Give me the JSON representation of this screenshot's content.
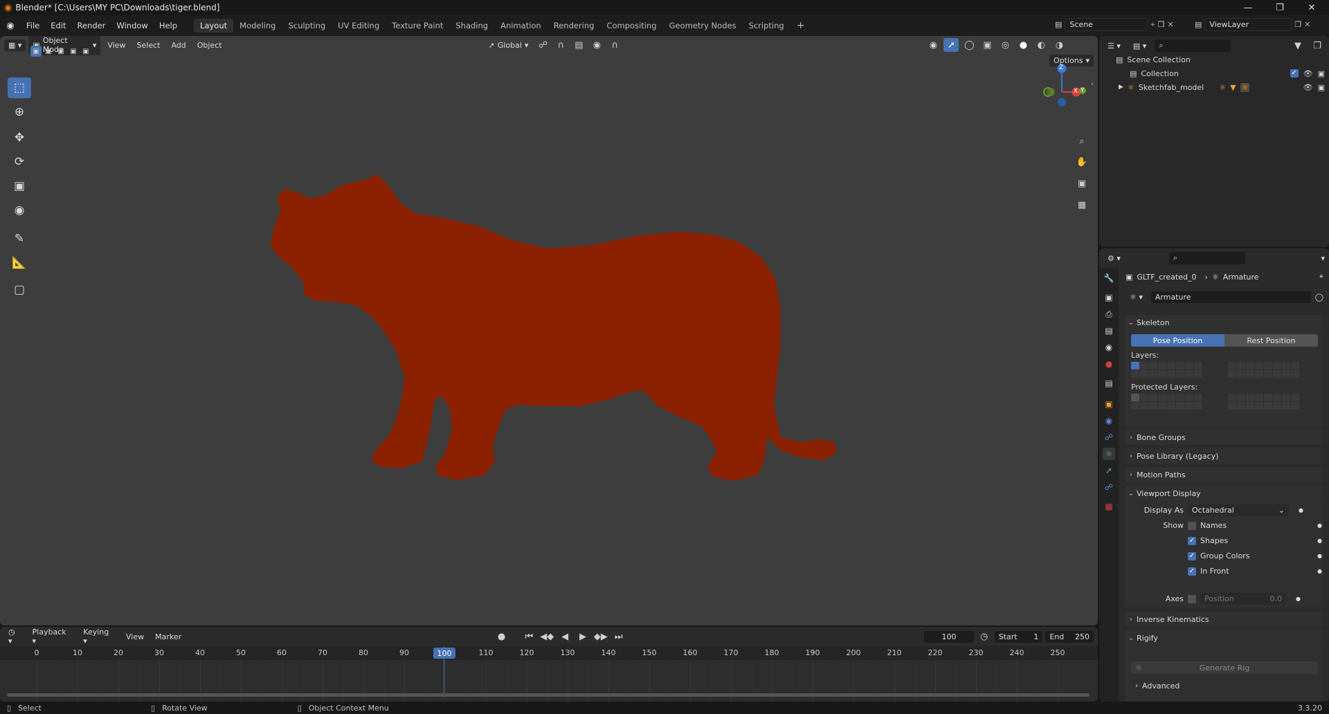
{
  "window": {
    "title": "Blender* [C:\\Users\\MY PC\\Downloads\\tiger.blend]",
    "version": "3.3.20"
  },
  "menus": [
    "File",
    "Edit",
    "Render",
    "Window",
    "Help"
  ],
  "workspaces": [
    "Layout",
    "Modeling",
    "Sculpting",
    "UV Editing",
    "Texture Paint",
    "Shading",
    "Animation",
    "Rendering",
    "Compositing",
    "Geometry Nodes",
    "Scripting"
  ],
  "active_workspace": "Layout",
  "scene": {
    "name": "Scene",
    "view_layer": "ViewLayer"
  },
  "viewport": {
    "mode": "Object Mode",
    "menu": [
      "View",
      "Select",
      "Add",
      "Object"
    ],
    "transform_orientation": "Global",
    "options_label": "Options",
    "gizmo_labels": {
      "z": "Z",
      "y": "Y",
      "x": "X"
    },
    "model_color": "#8a2000",
    "background_color": "#3d3d3d"
  },
  "tools": [
    "select-box-icon",
    "cursor-icon",
    "move-icon",
    "rotate-icon",
    "scale-icon",
    "transform-icon",
    "annotate-icon",
    "measure-icon",
    "add-cube-icon"
  ],
  "timeline": {
    "menus": [
      "Playback",
      "Keying",
      "View",
      "Marker"
    ],
    "current_frame": "100",
    "start_label": "Start",
    "start": "1",
    "end_label": "End",
    "end": "250",
    "ticks": [
      "0",
      "10",
      "20",
      "30",
      "40",
      "50",
      "60",
      "70",
      "80",
      "90",
      "100",
      "110",
      "120",
      "130",
      "140",
      "150",
      "160",
      "170",
      "180",
      "190",
      "200",
      "210",
      "220",
      "230",
      "240",
      "250"
    ]
  },
  "status": {
    "left": "Select",
    "middle": "Rotate View",
    "right": "Object Context Menu"
  },
  "outliner": {
    "rows": [
      {
        "label": "Scene Collection"
      },
      {
        "label": "Collection"
      },
      {
        "label": "Sketchfab_model"
      }
    ]
  },
  "properties": {
    "breadcrumb": {
      "object": "GLTF_created_0",
      "data": "Armature"
    },
    "datablock": "Armature",
    "skeleton": {
      "title": "Skeleton",
      "pose_position": "Pose Position",
      "rest_position": "Rest Position",
      "layers_label": "Layers:",
      "protected_label": "Protected Layers:"
    },
    "collapsed_panels": [
      "Bone Groups",
      "Pose Library (Legacy)",
      "Motion Paths"
    ],
    "viewport_display": {
      "title": "Viewport Display",
      "display_as_label": "Display As",
      "display_as": "Octahedral",
      "show_label": "Show",
      "names": "Names",
      "names_on": false,
      "shapes": "Shapes",
      "shapes_on": true,
      "group_colors": "Group Colors",
      "group_colors_on": true,
      "in_front": "In Front",
      "in_front_on": true,
      "axes_label": "Axes",
      "position_label": "Position",
      "position_value": "0.0"
    },
    "inverse_kinematics": "Inverse Kinematics",
    "rigify": {
      "title": "Rigify",
      "generate": "Generate Rig",
      "advanced": "Advanced"
    }
  },
  "accent": "#4772b3"
}
